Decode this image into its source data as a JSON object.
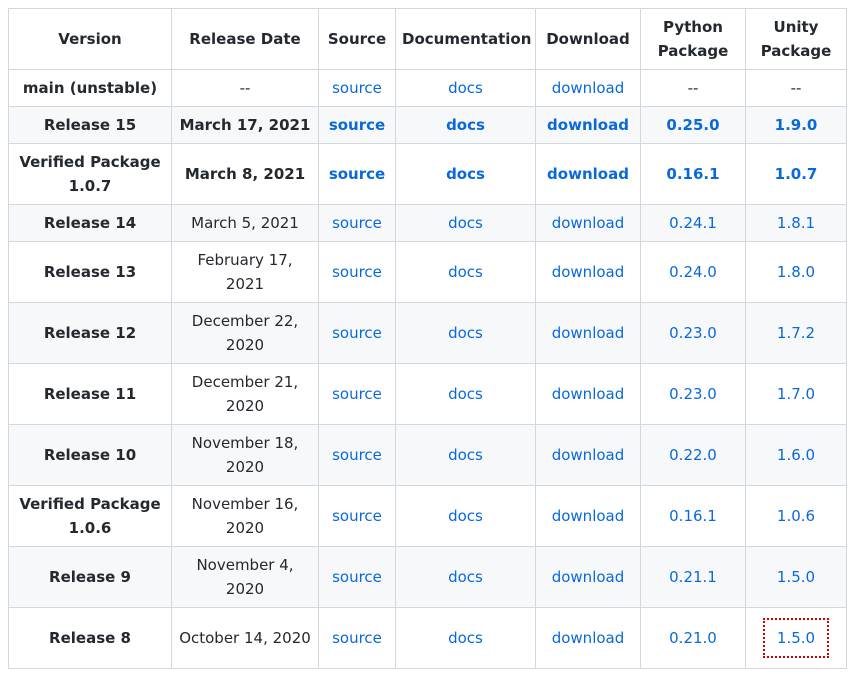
{
  "headers": [
    "Version",
    "Release Date",
    "Source",
    "Documentation",
    "Download",
    "Python Package",
    "Unity Package"
  ],
  "rows": [
    {
      "version": "main (unstable)",
      "date": "--",
      "source": "source",
      "docs": "docs",
      "download": "download",
      "python": "--",
      "unity": "--"
    },
    {
      "version": "Release 15",
      "date": "March 17, 2021",
      "source": "source",
      "docs": "docs",
      "download": "download",
      "python": "0.25.0",
      "unity": "1.9.0"
    },
    {
      "version": "Verified Package 1.0.7",
      "date": "March 8, 2021",
      "source": "source",
      "docs": "docs",
      "download": "download",
      "python": "0.16.1",
      "unity": "1.0.7"
    },
    {
      "version": "Release 14",
      "date": "March 5, 2021",
      "source": "source",
      "docs": "docs",
      "download": "download",
      "python": "0.24.1",
      "unity": "1.8.1"
    },
    {
      "version": "Release 13",
      "date": "February 17, 2021",
      "source": "source",
      "docs": "docs",
      "download": "download",
      "python": "0.24.0",
      "unity": "1.8.0"
    },
    {
      "version": "Release 12",
      "date": "December 22, 2020",
      "source": "source",
      "docs": "docs",
      "download": "download",
      "python": "0.23.0",
      "unity": "1.7.2"
    },
    {
      "version": "Release 11",
      "date": "December 21, 2020",
      "source": "source",
      "docs": "docs",
      "download": "download",
      "python": "0.23.0",
      "unity": "1.7.0"
    },
    {
      "version": "Release 10",
      "date": "November 18, 2020",
      "source": "source",
      "docs": "docs",
      "download": "download",
      "python": "0.22.0",
      "unity": "1.6.0"
    },
    {
      "version": "Verified Package 1.0.6",
      "date": "November 16, 2020",
      "source": "source",
      "docs": "docs",
      "download": "download",
      "python": "0.16.1",
      "unity": "1.0.6"
    },
    {
      "version": "Release 9",
      "date": "November 4, 2020",
      "source": "source",
      "docs": "docs",
      "download": "download",
      "python": "0.21.1",
      "unity": "1.5.0"
    },
    {
      "version": "Release 8",
      "date": "October 14, 2020",
      "source": "source",
      "docs": "docs",
      "download": "download",
      "python": "0.21.0",
      "unity": "1.5.0"
    }
  ]
}
